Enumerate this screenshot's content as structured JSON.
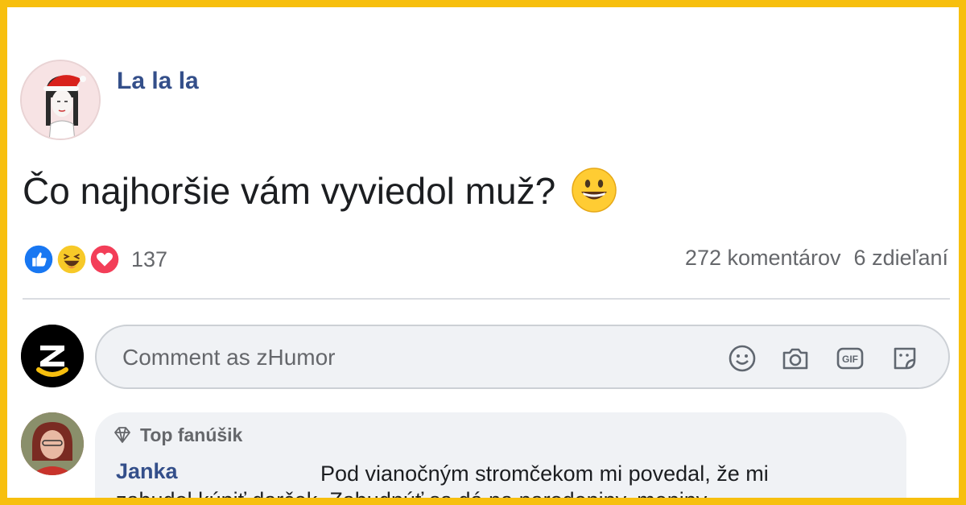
{
  "post": {
    "author": "La la la",
    "text": "Čo najhoršie vám vyviedol muž?",
    "emoji": "grinning-face-icon"
  },
  "reactions": {
    "types": [
      "like-icon",
      "haha-icon",
      "love-icon"
    ],
    "count": "137",
    "comments": "272 komentárov",
    "shares": "6 zdieľaní"
  },
  "composer": {
    "placeholder": "Comment as zHumor",
    "tools": [
      "emoji-icon",
      "camera-icon",
      "gif-icon",
      "sticker-icon"
    ]
  },
  "comment": {
    "badge": "Top fanúšik",
    "name": "Janka",
    "text": "Pod vianočným stromčekom mi povedal, že mi",
    "text_continued": "zabudol kúpiť darček. Zabudnúť sa dá na narodeniny, meniny"
  },
  "colors": {
    "frame": "#f7bf0e",
    "name_blue": "#344f8a",
    "muted": "#65676b"
  }
}
